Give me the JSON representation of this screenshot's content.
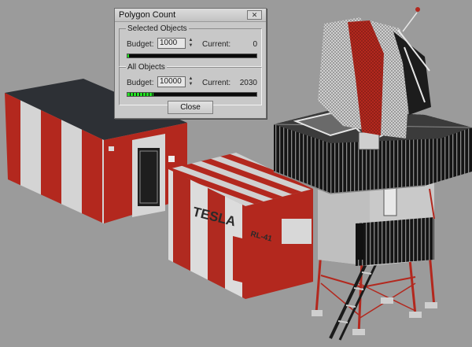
{
  "dialog": {
    "title": "Polygon Count",
    "close_glyph": "✕",
    "close_button": "Close",
    "selected": {
      "label": "Selected Objects",
      "budget_label": "Budget:",
      "budget_value": "1000",
      "current_label": "Current:",
      "current_value": "0",
      "progress": 0.01
    },
    "all": {
      "label": "All Objects",
      "budget_label": "Budget:",
      "budget_value": "10000",
      "current_label": "Current:",
      "current_value": "2030",
      "progress": 0.2
    }
  },
  "scene": {
    "sign_text": "TESLA",
    "sign_model": "RL-41",
    "colors": {
      "background": "#9b9b9b",
      "red": "#b3281e",
      "white": "#d8d8d8",
      "roof": "#2d3035",
      "black": "#111111",
      "progress": "#20e020"
    }
  }
}
